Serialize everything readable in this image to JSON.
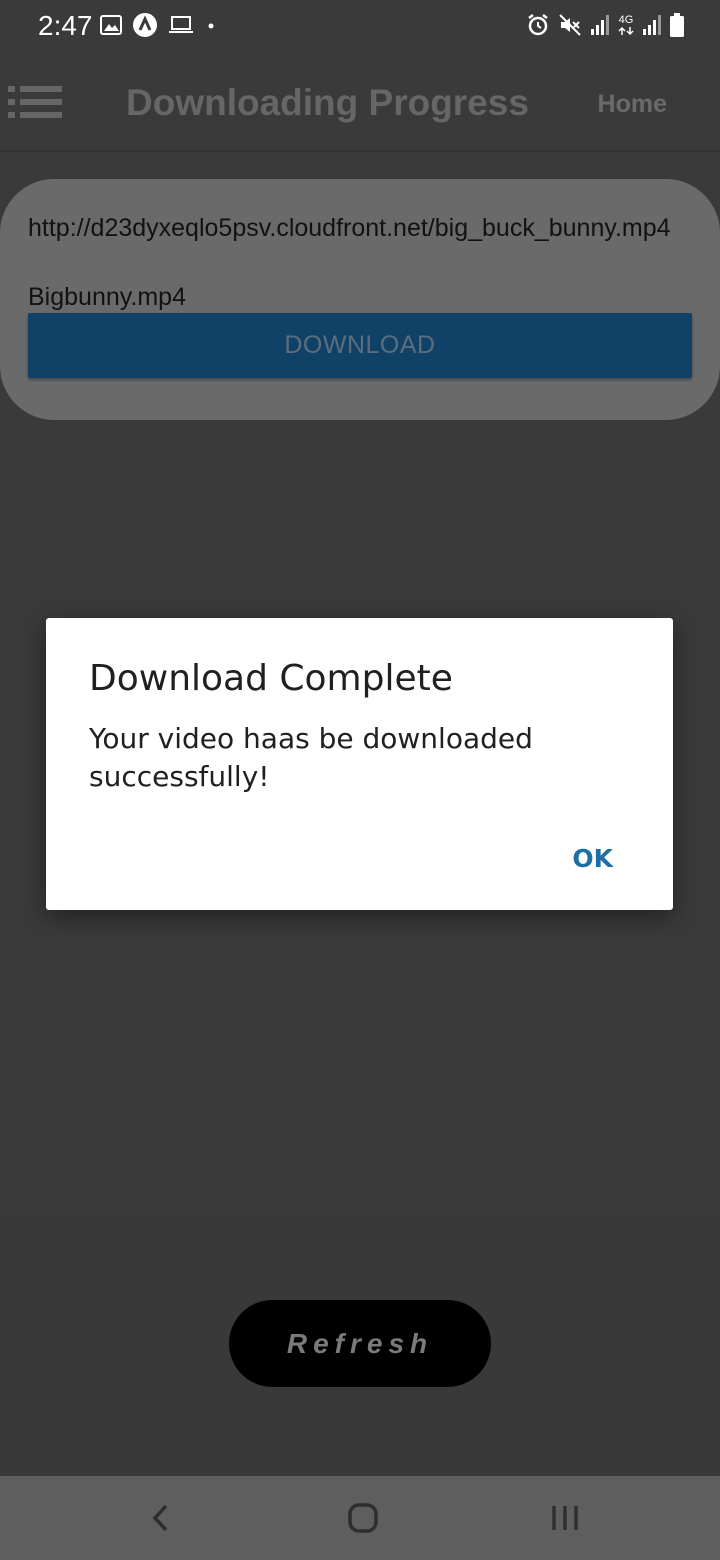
{
  "status_bar": {
    "time": "2:47",
    "left_icons": [
      "image-icon",
      "app-a-icon",
      "laptop-icon",
      "dot-icon"
    ],
    "right_icons": [
      "alarm-icon",
      "mute-icon",
      "signal-icon",
      "4g-icon",
      "signal-icon",
      "battery-icon"
    ],
    "network_label": "4G"
  },
  "app_bar": {
    "title": "Downloading Progress",
    "home_label": "Home"
  },
  "download_card": {
    "url": "http://d23dyxeqlo5psv.cloudfront.net/big_buck_bunny.mp4",
    "filename": "Bigbunny.mp4",
    "button_label": "DOWNLOAD"
  },
  "refresh": {
    "label": "Refresh"
  },
  "dialog": {
    "title": "Download Complete",
    "message": "Your video haas be downloaded successfully!",
    "ok_label": "OK"
  },
  "colors": {
    "background": "#3a3a3a",
    "card": "#6a6a6a",
    "download_button": "#0f4266",
    "accent": "#1d6fa5",
    "dialog": "#ffffff"
  }
}
